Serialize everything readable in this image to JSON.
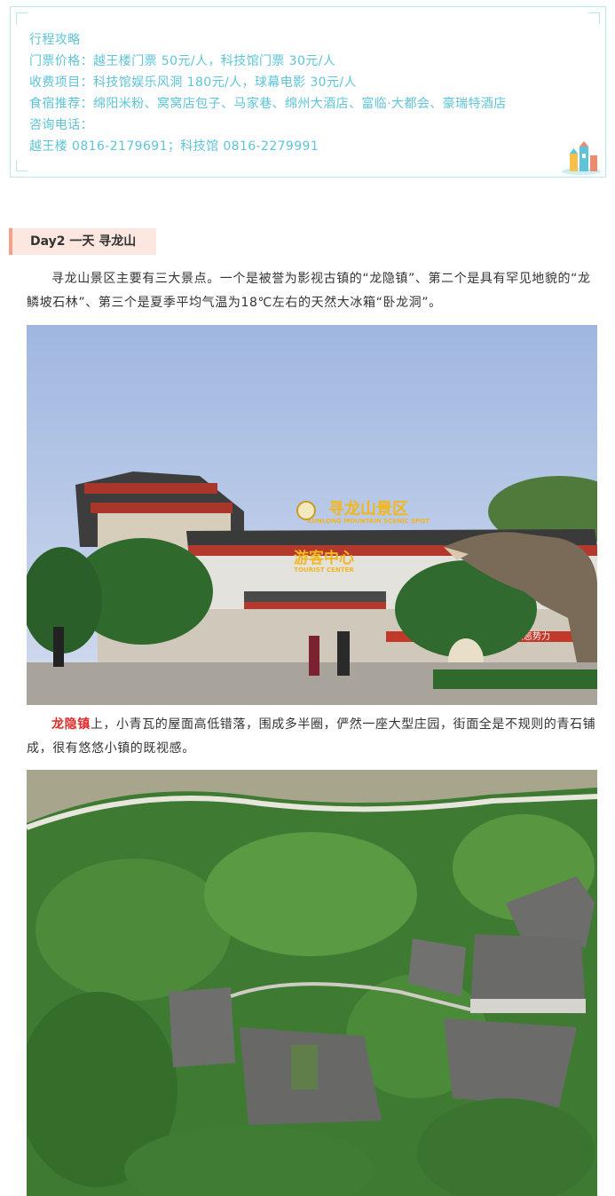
{
  "guide": {
    "title": "行程攻略",
    "tickets": "门票价格：越王楼门票 50元/人，科技馆门票 30元/人",
    "charges": "收费项目：科技馆娱乐风洞 180元/人，球幕电影 30元/人",
    "food": "食宿推荐：绵阳米粉、窝窝店包子、马家巷、绵州大酒店、富临·大都会、豪瑞特酒店",
    "phone_label": "咨询电话：",
    "phones": "越王楼 0816-2179691；科技馆 0816-2279991"
  },
  "day2": {
    "header": "Day2 一天 寻龙山",
    "intro": "寻龙山景区主要有三大景点。一个是被誉为影视古镇的“龙隐镇”、第二个是具有罕见地貌的“龙鳞坡石林”、第三个是夏季平均气温为18℃左右的天然大冰箱“卧龙洞”。",
    "town_name": "龙隐镇",
    "town_desc": "上，小青瓦的屋面高低错落，围成多半圈，俨然一座大型庄园，街面全是不规则的青石铺成，很有悠悠小镇的既视感。"
  },
  "photo1": {
    "sign_main": "寻龙山景区",
    "sign_sub": "XUNLONG MOUNTAIN SCENIC SPOT",
    "center_main": "游客中心",
    "center_sub": "TOURIST CENTER",
    "banner": "打击黑恶势力"
  },
  "colors": {
    "accent_text": "#5ec5d9",
    "highlight": "#e22a2a",
    "header_bg": "#fbe7df",
    "header_bar": "#f1a288"
  }
}
